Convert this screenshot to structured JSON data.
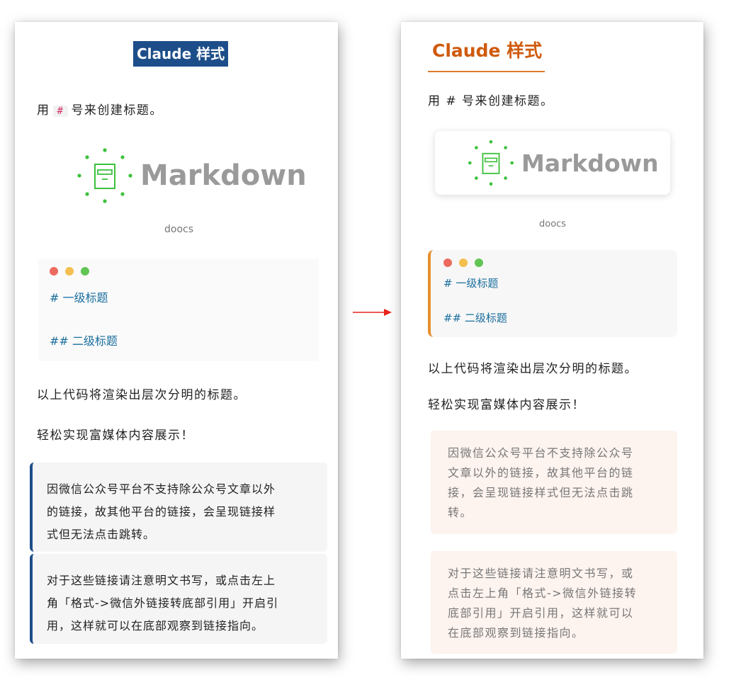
{
  "left": {
    "title": "Claude 样式",
    "heading_text_prefix": "用",
    "heading_code": "#",
    "heading_text_suffix": "号来创建标题。",
    "logo_word": "Markdown",
    "logo_caption": "doocs",
    "code_lines": [
      "#  一级标题",
      "##  二级标题"
    ],
    "para1": "以上代码将渲染出层次分明的标题。",
    "para2": "轻松实现富媒体内容展示！",
    "quote1_lines": [
      "因微信公众号平台不支持除公众号文章以外",
      "的链接，故其他平台的链接，会呈现链接样",
      "式但无法点击跳转。"
    ],
    "quote2_lines": [
      "对于这些链接请注意明文书写，或点击左上",
      "角「格式->微信外链接转底部引用」开启引",
      "用，这样就可以在底部观察到链接指向。"
    ]
  },
  "right": {
    "title": "Claude 样式",
    "heading_text": "用 # 号来创建标题。",
    "logo_word": "Markdown",
    "logo_caption": "doocs",
    "code_lines": [
      "#  一级标题",
      "##  二级标题"
    ],
    "para1": "以上代码将渲染出层次分明的标题。",
    "para2": "轻松实现富媒体内容展示！",
    "quote1_lines": [
      "因微信公众号平台不支持除公众号",
      "文章以外的链接，故其他平台的链",
      "接，会呈现链接样式但无法点击跳",
      "转。"
    ],
    "quote2_lines": [
      "对于这些链接请注意明文书写，或",
      "点击左上角「格式->微信外链接转",
      "底部引用」开启引用，这样就可以",
      "在底部观察到链接指向。"
    ]
  },
  "colors": {
    "left_accent": "#1d4e89",
    "right_accent": "#cf5a0c",
    "mac_red": "#ed6a5e",
    "mac_yellow": "#f4bf4f",
    "mac_green": "#61c554",
    "logo_green": "#3cc13b",
    "arrow_red": "#e8221b"
  },
  "icons": [
    "archive-box-icon",
    "arrow-right-icon"
  ]
}
